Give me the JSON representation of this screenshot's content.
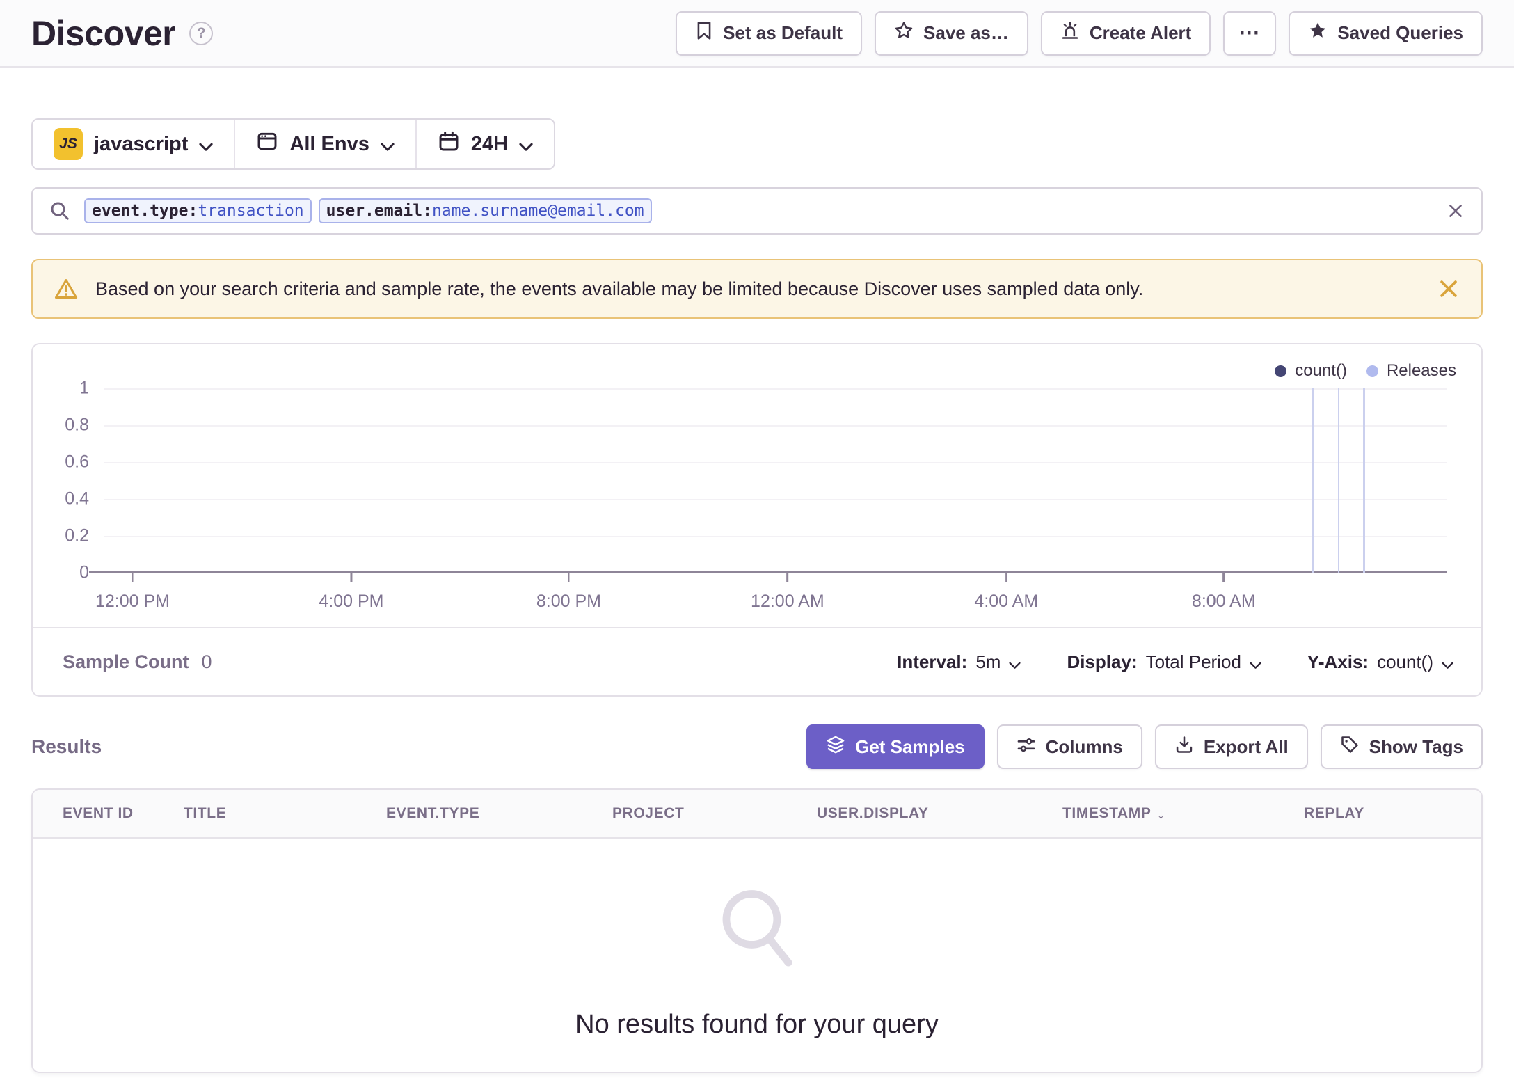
{
  "header": {
    "title": "Discover",
    "help": "?",
    "actions": {
      "set_default": "Set as Default",
      "save_as": "Save as…",
      "create_alert": "Create Alert",
      "more": "⋯",
      "saved_queries": "Saved Queries"
    }
  },
  "filters": {
    "project": {
      "badge": "JS",
      "label": "javascript"
    },
    "environment": {
      "label": "All Envs"
    },
    "time": {
      "label": "24H"
    }
  },
  "search": {
    "tokens": [
      {
        "key": "event.type:",
        "value": "transaction"
      },
      {
        "key": "user.email:",
        "value": "name.surname@email.com"
      }
    ]
  },
  "warning": {
    "message": "Based on your search criteria and sample rate, the events available may be limited because Discover uses sampled data only."
  },
  "chart_data": {
    "type": "line",
    "title": "",
    "legend": [
      {
        "name": "count()",
        "color": "#444674"
      },
      {
        "name": "Releases",
        "color": "#B0BAEE"
      }
    ],
    "series": [
      {
        "name": "count()",
        "values": []
      }
    ],
    "ylim": [
      0,
      1
    ],
    "y_ticks": [
      "1",
      "0.8",
      "0.6",
      "0.4",
      "0.2",
      "0"
    ],
    "x_ticks": [
      "12:00 PM",
      "4:00 PM",
      "8:00 PM",
      "12:00 AM",
      "4:00 AM",
      "8:00 AM"
    ],
    "x_tick_percent": [
      2.1,
      18.4,
      34.6,
      50.9,
      67.2,
      83.4
    ],
    "release_marker_percent": [
      90.0,
      91.9,
      93.8
    ],
    "grid": true,
    "legend_position": "top-right"
  },
  "chart_footer": {
    "sample_count_label": "Sample Count",
    "sample_count_value": "0",
    "interval_label": "Interval:",
    "interval_value": "5m",
    "display_label": "Display:",
    "display_value": "Total Period",
    "yaxis_label": "Y-Axis:",
    "yaxis_value": "count()"
  },
  "results": {
    "heading": "Results",
    "buttons": {
      "get_samples": "Get Samples",
      "columns": "Columns",
      "export_all": "Export All",
      "show_tags": "Show Tags"
    }
  },
  "table": {
    "columns": [
      "EVENT ID",
      "TITLE",
      "EVENT.TYPE",
      "PROJECT",
      "USER.DISPLAY",
      "TIMESTAMP",
      "REPLAY"
    ],
    "sorted_column": "TIMESTAMP",
    "sort_direction": "desc",
    "empty_message": "No results found for your query"
  },
  "colors": {
    "accent_purple": "#6C5FC7",
    "dark_text": "#2B2233",
    "muted_text": "#7F7491",
    "warning_bg": "#FCF6E6",
    "warning_border": "#E9C377",
    "warning_icon": "#D9A43B",
    "token_bg": "#F0F3FD",
    "token_border": "#A9B2EA",
    "token_value_text": "#4052C4",
    "js_badge_bg": "#F2C12E",
    "count_series": "#444674",
    "releases_marker": "#B0BAEE"
  }
}
